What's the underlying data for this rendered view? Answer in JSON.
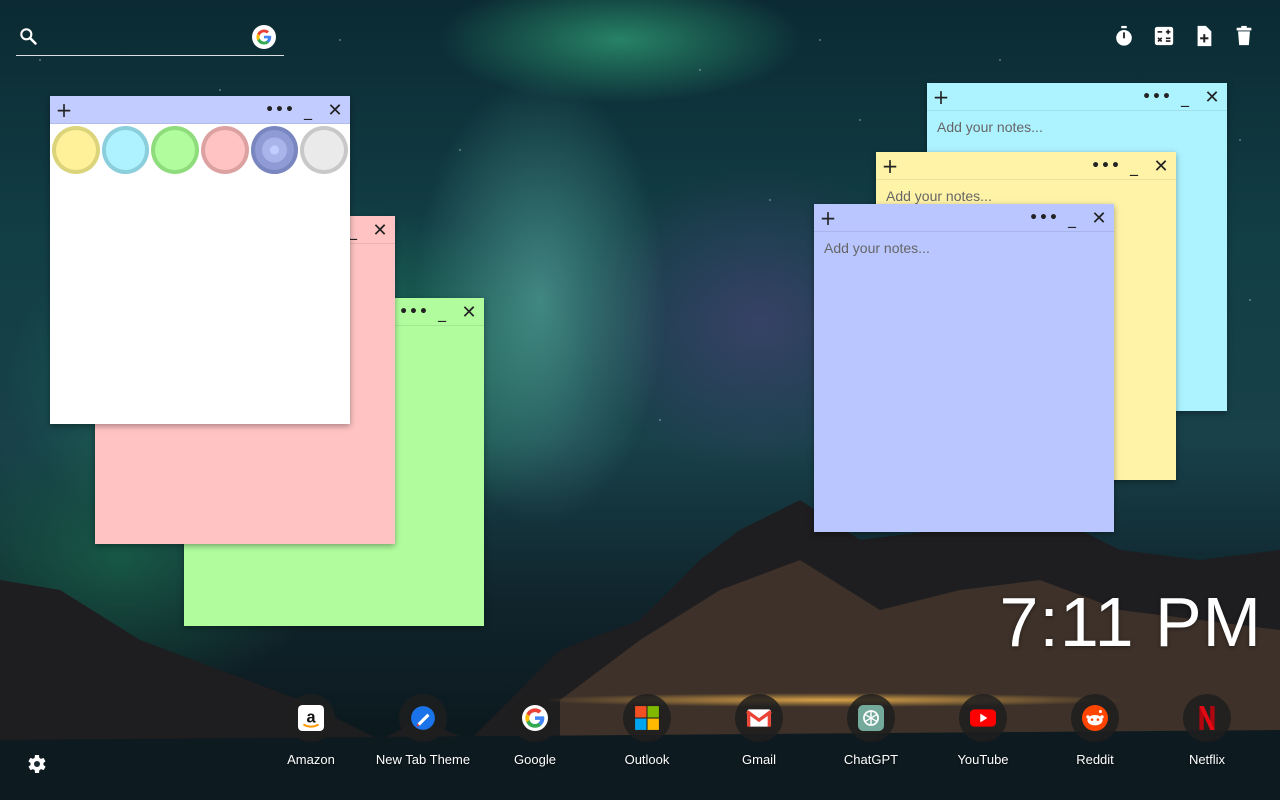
{
  "search": {
    "placeholder": "",
    "engine_icon": "google-icon"
  },
  "toolbar": {
    "items": [
      {
        "name": "timer-icon"
      },
      {
        "name": "calculator-icon"
      },
      {
        "name": "new-note-icon"
      },
      {
        "name": "trash-icon"
      }
    ]
  },
  "notes": [
    {
      "id": "green",
      "color": "#b1fd9e",
      "placeholder": ""
    },
    {
      "id": "pink",
      "color": "#ffc3c3",
      "placeholder": ""
    },
    {
      "id": "white",
      "color": "#ffffff",
      "header_color": "#c2ccff",
      "palette": [
        "#fff09a",
        "#aef1ff",
        "#b1fd9e",
        "#ffc3c3",
        "#a9b4ea",
        "#eaeaea"
      ]
    },
    {
      "id": "cyan",
      "color": "#adf3ff",
      "placeholder": "Add your notes..."
    },
    {
      "id": "yellow",
      "color": "#fff3a8",
      "placeholder": "Add your notes..."
    },
    {
      "id": "blue",
      "color": "#b9c6ff",
      "placeholder": "Add your notes..."
    }
  ],
  "note_controls": {
    "add": "+",
    "more": "•••",
    "minimize": "_",
    "close": "✕"
  },
  "clock": {
    "time": "7:11 PM"
  },
  "shortcuts": [
    {
      "label": "Amazon",
      "icon": "amazon-icon"
    },
    {
      "label": "New Tab Theme",
      "icon": "new-tab-theme-icon"
    },
    {
      "label": "Google",
      "icon": "google-icon"
    },
    {
      "label": "Outlook",
      "icon": "outlook-icon"
    },
    {
      "label": "Gmail",
      "icon": "gmail-icon"
    },
    {
      "label": "ChatGPT",
      "icon": "chatgpt-icon"
    },
    {
      "label": "YouTube",
      "icon": "youtube-icon"
    },
    {
      "label": "Reddit",
      "icon": "reddit-icon"
    },
    {
      "label": "Netflix",
      "icon": "netflix-icon"
    }
  ],
  "settings": {
    "icon": "gear-icon"
  }
}
